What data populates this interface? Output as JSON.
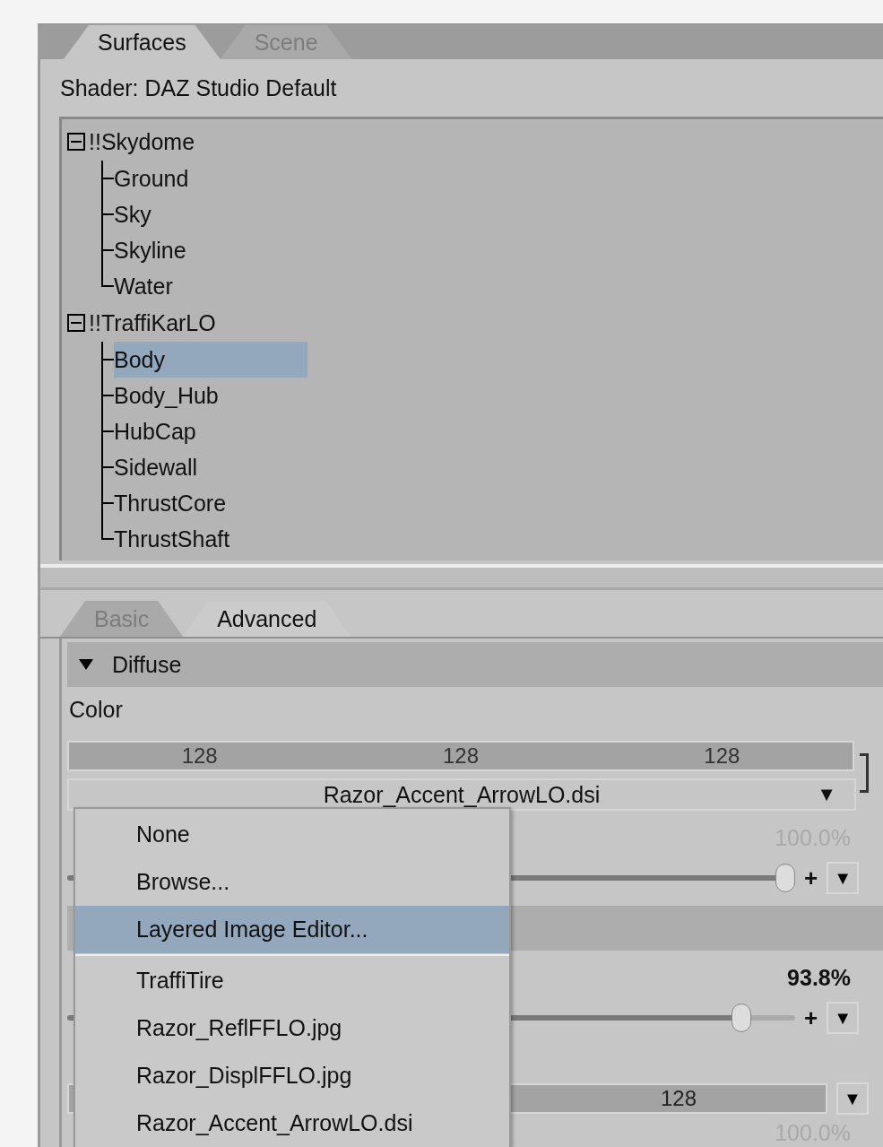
{
  "tabs": [
    {
      "label": "Surfaces",
      "selected": true
    },
    {
      "label": "Scene",
      "selected": false
    }
  ],
  "shader": "Shader: DAZ Studio Default",
  "tree": [
    {
      "label": "!!Skydome",
      "expanded": true,
      "selected": false,
      "children": [
        {
          "label": "Ground",
          "selected": false
        },
        {
          "label": "Sky",
          "selected": false
        },
        {
          "label": "Skyline",
          "selected": false
        },
        {
          "label": "Water",
          "selected": false
        }
      ]
    },
    {
      "label": "!!TraffiKarLO",
      "expanded": true,
      "selected": false,
      "children": [
        {
          "label": "Body",
          "selected": true
        },
        {
          "label": "Body_Hub",
          "selected": false
        },
        {
          "label": "HubCap",
          "selected": false
        },
        {
          "label": "Sidewall",
          "selected": false
        },
        {
          "label": "ThrustCore",
          "selected": false
        },
        {
          "label": "ThrustShaft",
          "selected": false
        }
      ]
    }
  ],
  "subtabs": [
    {
      "label": "Basic",
      "selected": false
    },
    {
      "label": "Advanced",
      "selected": true
    }
  ],
  "section": {
    "title": "Diffuse",
    "expanded": true
  },
  "color_label": "Color",
  "rgb": [
    "128",
    "128",
    "128"
  ],
  "map_dropdown": {
    "value": "Razor_Accent_ArrowLO.dsi",
    "arrow": "▼"
  },
  "params": [
    {
      "kind": "percent",
      "text": "100.0%",
      "disabled": true
    },
    {
      "kind": "slider",
      "level": 1.0,
      "plus": "+",
      "arrow": "▼"
    },
    {
      "kind": "header"
    },
    {
      "kind": "percent",
      "text": "93.8%",
      "disabled": false
    },
    {
      "kind": "slider",
      "level": 0.938,
      "plus": "+",
      "arrow": "▼"
    },
    {
      "kind": "spacer"
    },
    {
      "kind": "value",
      "text": "128",
      "arrow": "▼"
    },
    {
      "kind": "percent",
      "text": "100.0%",
      "disabled": true
    }
  ],
  "menu": [
    {
      "label": "None",
      "selected": false
    },
    {
      "label": "Browse...",
      "selected": false
    },
    {
      "label": "Layered Image Editor...",
      "selected": true,
      "separator_after": true
    },
    {
      "label": "TraffiTire",
      "selected": false
    },
    {
      "label": "Razor_ReflFFLO.jpg",
      "selected": false
    },
    {
      "label": "Razor_DisplFFLO.jpg",
      "selected": false
    },
    {
      "label": "Razor_Accent_ArrowLO.dsi",
      "selected": false
    }
  ]
}
